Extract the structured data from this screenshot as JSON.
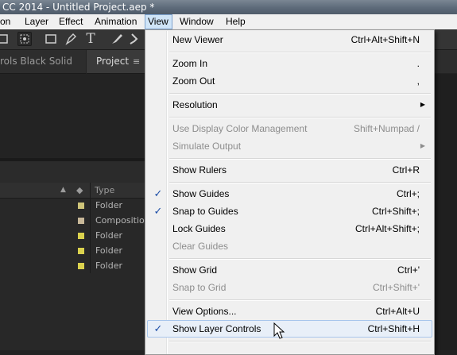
{
  "window": {
    "title": "CC 2014 - Untitled Project.aep *"
  },
  "menubar": {
    "items": [
      {
        "label": "on"
      },
      {
        "label": "Layer"
      },
      {
        "label": "Effect"
      },
      {
        "label": "Animation"
      },
      {
        "label": "View"
      },
      {
        "label": "Window"
      },
      {
        "label": "Help"
      }
    ]
  },
  "panels": {
    "effect_controls_tab": "rols Black Solid",
    "project_tab": "Project",
    "panel_menu_glyph": "≡",
    "columns": {
      "type": "Type"
    },
    "rows": [
      {
        "name": "Folder",
        "color": "#cfc57a"
      },
      {
        "name": "Compositio",
        "color": "#c8b899"
      },
      {
        "name": "Folder",
        "color": "#dbd24e"
      },
      {
        "name": "Folder",
        "color": "#dbd24e"
      },
      {
        "name": "Folder",
        "color": "#dbd24e"
      }
    ]
  },
  "view_menu": {
    "items": [
      {
        "label": "New Viewer",
        "shortcut": "Ctrl+Alt+Shift+N"
      },
      {
        "label": "Zoom In",
        "shortcut": "."
      },
      {
        "label": "Zoom Out",
        "shortcut": ","
      },
      {
        "label": "Resolution",
        "shortcut": "",
        "submenu": true
      },
      {
        "label": "Use Display Color Management",
        "shortcut": "Shift+Numpad /",
        "disabled": true
      },
      {
        "label": "Simulate Output",
        "shortcut": "",
        "disabled": true,
        "submenu": true
      },
      {
        "label": "Show Rulers",
        "shortcut": "Ctrl+R"
      },
      {
        "label": "Show Guides",
        "shortcut": "Ctrl+;",
        "checked": true
      },
      {
        "label": "Snap to Guides",
        "shortcut": "Ctrl+Shift+;",
        "checked": true
      },
      {
        "label": "Lock Guides",
        "shortcut": "Ctrl+Alt+Shift+;"
      },
      {
        "label": "Clear Guides",
        "shortcut": "",
        "disabled": true
      },
      {
        "label": "Show Grid",
        "shortcut": "Ctrl+'"
      },
      {
        "label": "Snap to Grid",
        "shortcut": "Ctrl+Shift+'",
        "disabled": true
      },
      {
        "label": "View Options...",
        "shortcut": "Ctrl+Alt+U"
      },
      {
        "label": "Show Layer Controls",
        "shortcut": "Ctrl+Shift+H",
        "checked": true,
        "highlighted": true
      }
    ],
    "check_glyph": "✓",
    "submenu_glyph": "▶"
  },
  "toolbar": {
    "tools": [
      "hand-tool",
      "zoom-tool",
      "rectangle-tool",
      "pen-tool",
      "type-tool",
      "brush-tool",
      "clone-stamp-tool",
      "eraser-tool"
    ]
  }
}
